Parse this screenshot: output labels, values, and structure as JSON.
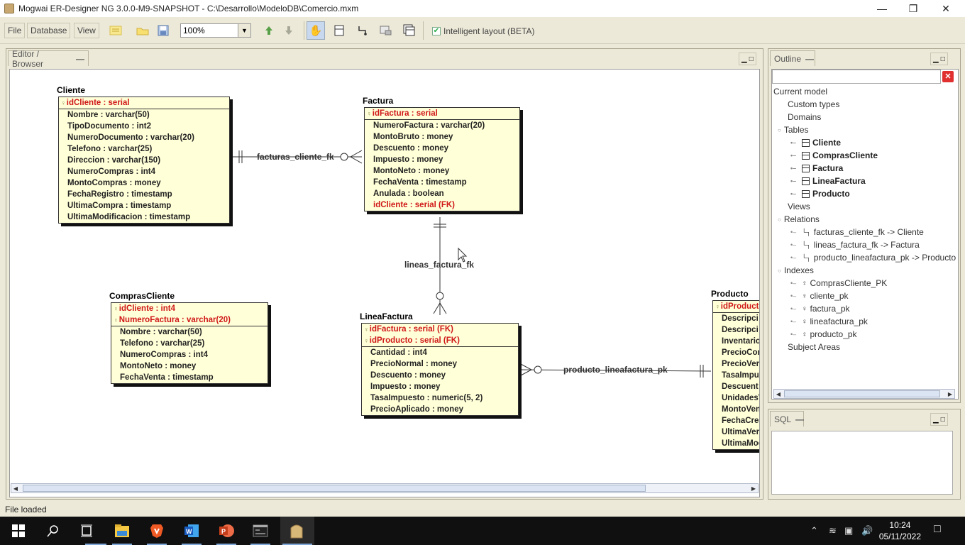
{
  "window": {
    "title": "Mogwai ER-Designer NG 3.0.0-M9-SNAPSHOT  - C:\\Desarrollo\\ModeloDB\\Comercio.mxm",
    "minimize_icon": "minimize-icon",
    "maximize_icon": "restore-icon",
    "close_icon": "close-icon"
  },
  "toolbar": {
    "menus": [
      "File",
      "Database",
      "View"
    ],
    "buttons": [
      "new-model-icon",
      "open-icon",
      "save-icon",
      "zoom-in-icon",
      "zoom-out-icon",
      "hand-tool-icon",
      "add-table-icon",
      "add-relation-icon",
      "add-comment-icon",
      "add-view-icon"
    ],
    "zoom_value": "100%",
    "intelligent_layout_label": "Intelligent layout (BETA)",
    "intelligent_layout_checked": true
  },
  "editor": {
    "tab_label": "Editor / Browser",
    "tables": [
      {
        "name": "Cliente",
        "keys": [
          "idCliente : serial"
        ],
        "attributes": [
          "Nombre : varchar(50)",
          "TipoDocumento : int2",
          "NumeroDocumento : varchar(20)",
          "Telefono : varchar(25)",
          "Direccion : varchar(150)",
          "NumeroCompras : int4",
          "MontoCompras : money",
          "FechaRegistro : timestamp",
          "UltimaCompra : timestamp",
          "UltimaModificacion : timestamp"
        ],
        "foreign_keys": []
      },
      {
        "name": "Factura",
        "keys": [
          "idFactura : serial"
        ],
        "attributes": [
          "NumeroFactura : varchar(20)",
          "MontoBruto : money",
          "Descuento : money",
          "Impuesto : money",
          "MontoNeto : money",
          "FechaVenta : timestamp",
          "Anulada : boolean"
        ],
        "foreign_keys": [
          "idCliente : serial (FK)"
        ]
      },
      {
        "name": "ComprasCliente",
        "keys": [
          "idCliente : int4",
          "NumeroFactura : varchar(20)"
        ],
        "attributes": [
          "Nombre : varchar(50)",
          "Telefono : varchar(25)",
          "NumeroCompras : int4",
          "MontoNeto : money",
          "FechaVenta : timestamp"
        ],
        "foreign_keys": []
      },
      {
        "name": "LineaFactura",
        "keys": [
          "idFactura : serial (FK)",
          "idProducto : serial (FK)"
        ],
        "attributes": [
          "Cantidad : int4",
          "PrecioNormal : money",
          "Descuento : money",
          "Impuesto : money",
          "TasaImpuesto : numeric(5, 2)",
          "PrecioAplicado : money"
        ],
        "foreign_keys": []
      },
      {
        "name": "Producto",
        "keys": [
          "idProducto"
        ],
        "attributes": [
          "Descripci",
          "Descripci",
          "Inventario",
          "PrecioCor",
          "PrecioVer",
          "TasaImpu",
          "Descuent",
          "UnidadesV",
          "MontoVen",
          "FechaCrea",
          "UltimaVer",
          "UltimaMoc"
        ],
        "foreign_keys": []
      }
    ],
    "relations": [
      "facturas_cliente_fk",
      "lineas_factura_fk",
      "producto_lineafactura_pk"
    ]
  },
  "outline": {
    "tab_label": "Outline",
    "search_value": "",
    "clear_icon": "clear-search-icon",
    "root": "Current model",
    "categories": {
      "custom_types": "Custom types",
      "domains": "Domains",
      "tables": "Tables",
      "views": "Views",
      "relations": "Relations",
      "indexes": "Indexes",
      "subject_areas": "Subject Areas"
    },
    "tables": [
      "Cliente",
      "ComprasCliente",
      "Factura",
      "LineaFactura",
      "Producto"
    ],
    "relations": [
      "facturas_cliente_fk -> Cliente",
      "lineas_factura_fk -> Factura",
      "producto_lineafactura_pk -> Producto"
    ],
    "indexes": [
      "ComprasCliente_PK",
      "cliente_pk",
      "factura_pk",
      "lineafactura_pk",
      "producto_pk"
    ]
  },
  "sql": {
    "tab_label": "SQL",
    "content": ""
  },
  "status": {
    "message": "File loaded"
  },
  "taskbar": {
    "apps": [
      "start-icon",
      "search-icon",
      "task-view-icon",
      "file-explorer-icon",
      "brave-browser-icon",
      "word-icon",
      "powerpoint-icon",
      "terminal-icon",
      "mogwai-app-icon"
    ],
    "time": "10:24",
    "date": "05/11/2022"
  },
  "colors": {
    "table_fill": "#ffffd8",
    "key_text": "#d01818",
    "panel_bg": "#ece9d8"
  }
}
